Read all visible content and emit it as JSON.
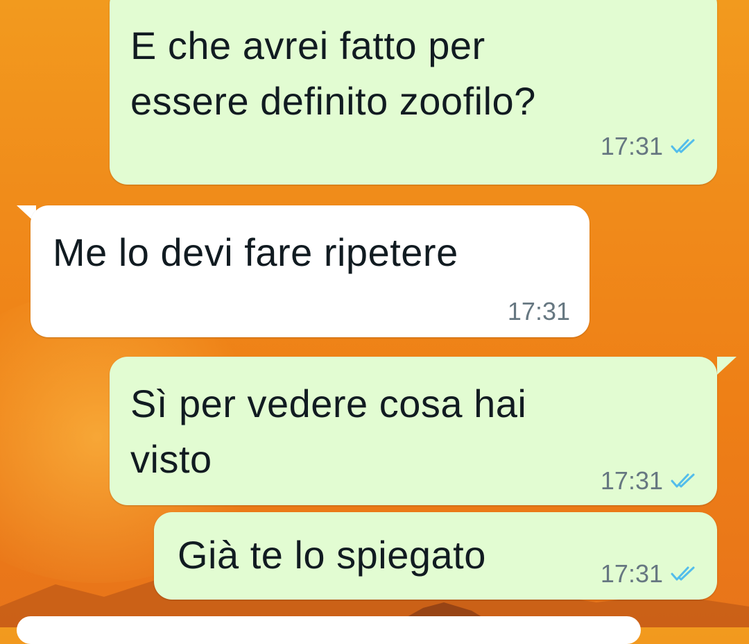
{
  "messages": [
    {
      "direction": "outgoing",
      "text": "E che avrei fatto per\nessere definito zoofilo?",
      "time": "17:31",
      "status_icon": "double-check-read-icon"
    },
    {
      "direction": "incoming",
      "text": "Me lo devi fare ripetere",
      "time": "17:31"
    },
    {
      "direction": "outgoing",
      "text": "Sì per vedere cosa hai\nvisto",
      "time": "17:31",
      "status_icon": "double-check-read-icon"
    },
    {
      "direction": "outgoing",
      "text": "Già te lo spiegato",
      "time": "17:31",
      "status_icon": "double-check-read-icon"
    }
  ],
  "colors": {
    "outgoing_bubble": "#e2fcd2",
    "incoming_bubble": "#ffffff",
    "read_tick": "#53bdeb",
    "time_text": "#667781",
    "wallpaper": "#f08a1a"
  }
}
